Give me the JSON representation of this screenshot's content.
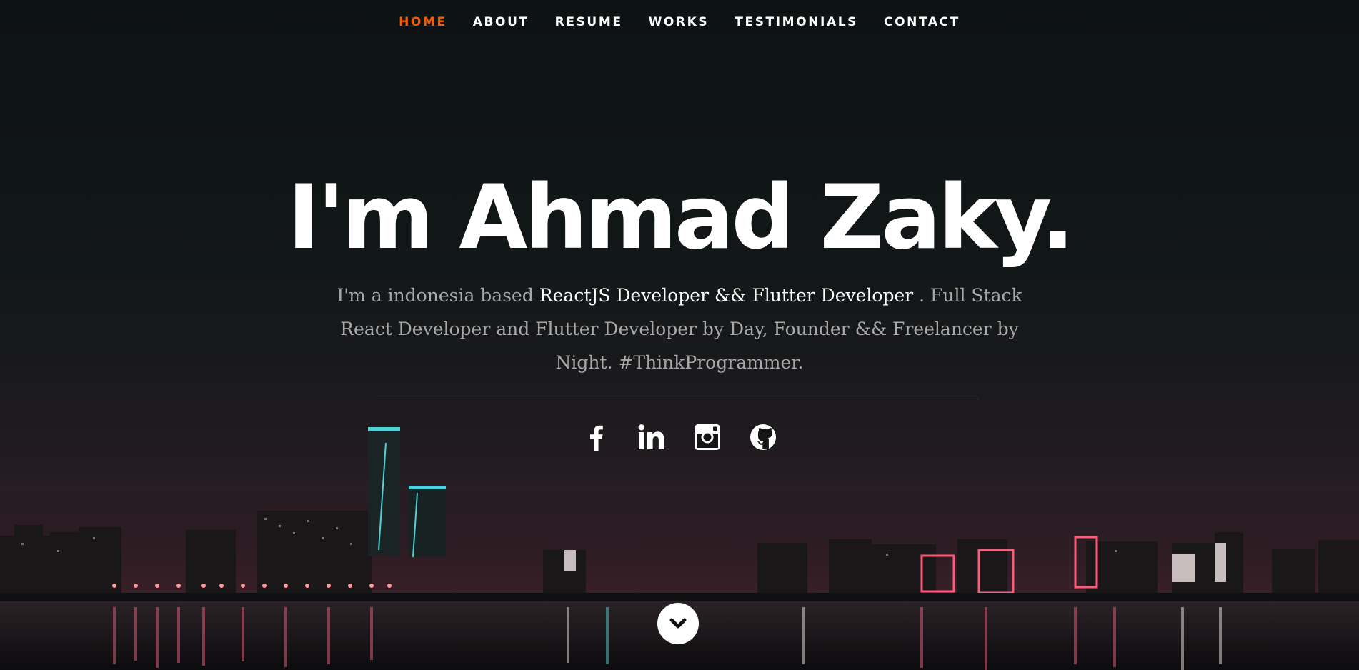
{
  "nav": {
    "items": [
      {
        "label": "HOME",
        "active": true
      },
      {
        "label": "ABOUT"
      },
      {
        "label": "RESUME"
      },
      {
        "label": "WORKS"
      },
      {
        "label": "TESTIMONIALS"
      },
      {
        "label": "CONTACT"
      }
    ],
    "active_color": "#f06000"
  },
  "hero": {
    "headline": "I'm Ahmad Zaky.",
    "intro_before": "I'm a indonesia based ",
    "intro_highlight": "ReactJS Developer && Flutter Developer",
    "intro_after": " . Full Stack React Developer and Flutter Developer by Day, Founder && Freelancer by Night. #ThinkProgrammer."
  },
  "social": [
    {
      "icon": "facebook-icon"
    },
    {
      "icon": "linkedin-icon"
    },
    {
      "icon": "instagram-icon"
    },
    {
      "icon": "github-icon"
    }
  ],
  "scroll_button": {
    "icon": "chevron-down-icon"
  }
}
